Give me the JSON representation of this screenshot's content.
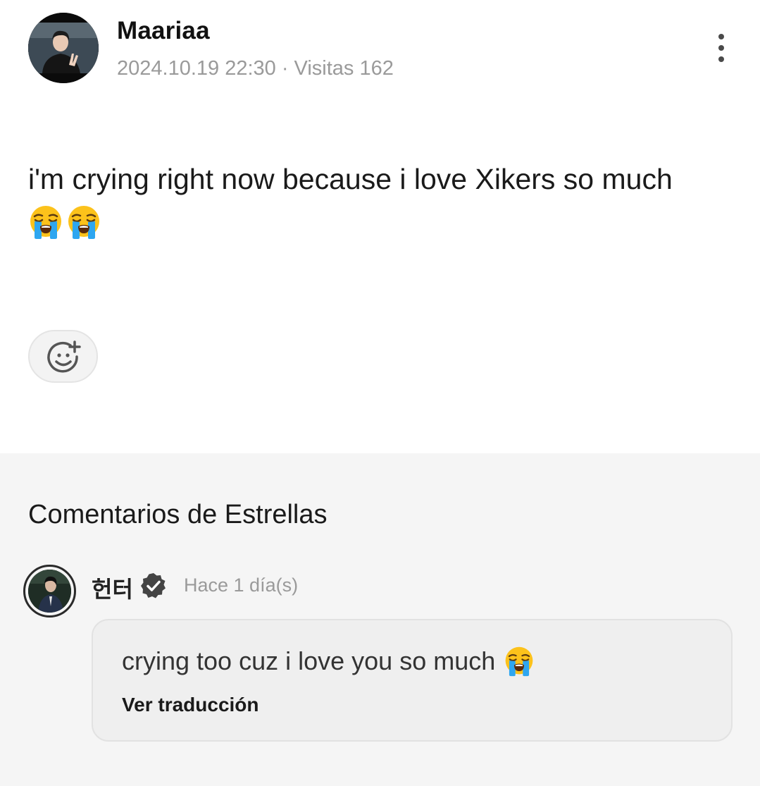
{
  "post": {
    "author": "Maariaa",
    "meta": "2024.10.19 22:30 · Visitas 162",
    "text": "i'm crying right now because i love Xikers so much",
    "emojis": [
      "loudly-crying-face",
      "loudly-crying-face"
    ],
    "more_icon": "more-vertical-icon",
    "react_icon": "add-reaction-icon"
  },
  "comments": {
    "title": "Comentarios de Estrellas",
    "items": [
      {
        "author": "헌터",
        "verified_icon": "verified-badge-icon",
        "time": "Hace 1 día(s)",
        "text": "crying too cuz i love you so much",
        "emoji": "loudly-crying-face",
        "translate_label": "Ver traducción"
      }
    ]
  },
  "colors": {
    "background": "#ffffff",
    "comments_background": "#f5f5f5",
    "meta_text": "#9a9a9a",
    "bubble": "#efefef",
    "emoji_yellow": "#fcc21b",
    "tears_blue": "#2ea6f0"
  }
}
